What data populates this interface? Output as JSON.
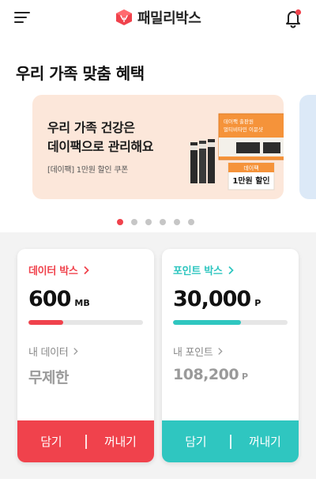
{
  "app": {
    "title": "패밀리박스"
  },
  "icons": {
    "menu": "menu-icon",
    "logo": "box-logo-icon",
    "notification": "bell-icon",
    "notification_badge": "notification-dot"
  },
  "section": {
    "title": "우리 가족 맞춤 혜택"
  },
  "banner": {
    "title_line1": "우리 가족 건강은",
    "title_line2": "데이팩으로 관리해요",
    "subtitle": "[데이팩] 1만원 할인 쿠폰",
    "product_line1": "데이팩 출판원",
    "product_line2": "멀티비타민 이뮨샷",
    "coupon_brand": "데이팩",
    "coupon_text": "1만원 할인"
  },
  "carousel": {
    "count": 6,
    "active_index": 0
  },
  "data_box": {
    "label": "데이터 박스",
    "amount": "600",
    "unit": "MB",
    "progress_percent": 30,
    "my_label": "내 데이터",
    "my_value": "무제한",
    "deposit_label": "담기",
    "withdraw_label": "꺼내기",
    "accent": "#f0424c"
  },
  "point_box": {
    "label": "포인트 박스",
    "amount": "30,000",
    "unit": "P",
    "progress_percent": 59,
    "my_label": "내 포인트",
    "my_value": "108,200",
    "my_unit": "P",
    "deposit_label": "담기",
    "withdraw_label": "꺼내기",
    "accent": "#2fc6c0"
  },
  "colors": {
    "brand_red": "#f0424c",
    "teal": "#2fc6c0",
    "banner_bg": "#fce7da",
    "banner_peek_bg": "#dce9f7",
    "orange": "#f5933a"
  }
}
